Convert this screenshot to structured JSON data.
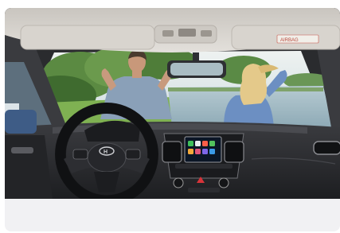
{
  "image": {
    "alt": "",
    "subject": "car-interior-view",
    "brand_logo": "H",
    "sticker_text": "AIRBAG"
  },
  "colors": {
    "cabin_dark": "#2a2b2e",
    "headliner": "#d9d6d1",
    "sky": "#dfe8ec",
    "trees": "#4e7a3a",
    "water": "#9fb9c4",
    "shirt_blue": "#6f8fb8",
    "card_bg": "#f1f1f3"
  }
}
